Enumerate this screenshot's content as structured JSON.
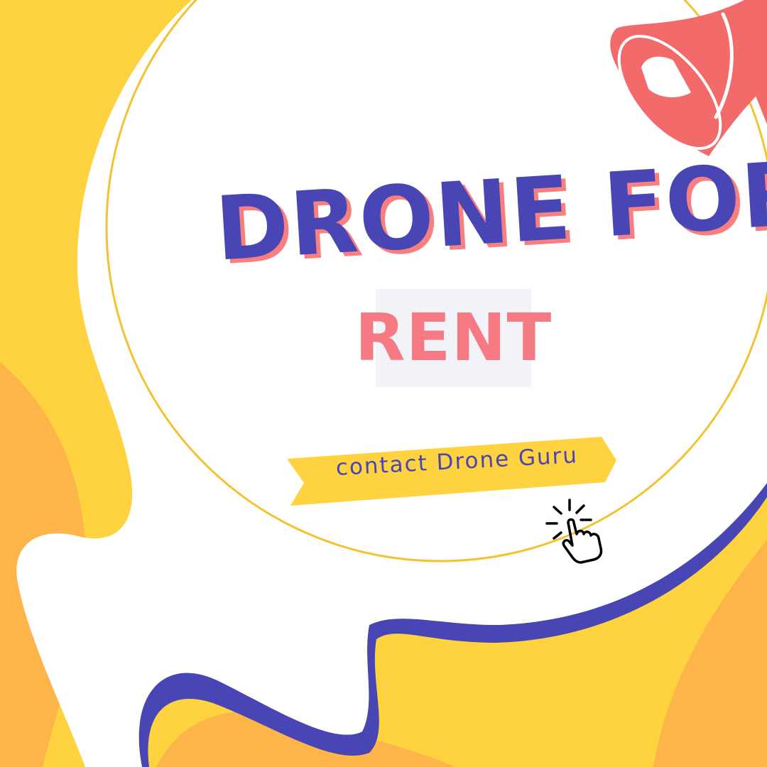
{
  "poster": {
    "headline": "DRONE FOR",
    "highlight": "RENT",
    "ribbon_text": "contact Drone Guru",
    "icons": [
      "megaphone-icon",
      "pointer-click-icon"
    ],
    "colors": {
      "background_yellow": "#ffd23f",
      "accent_orange": "#fdb54a",
      "headline_blue": "#4846b4",
      "highlight_coral": "#f67a83",
      "megaphone_coral": "#f36a6b",
      "ribbon_yellow": "#ffd23f"
    }
  }
}
